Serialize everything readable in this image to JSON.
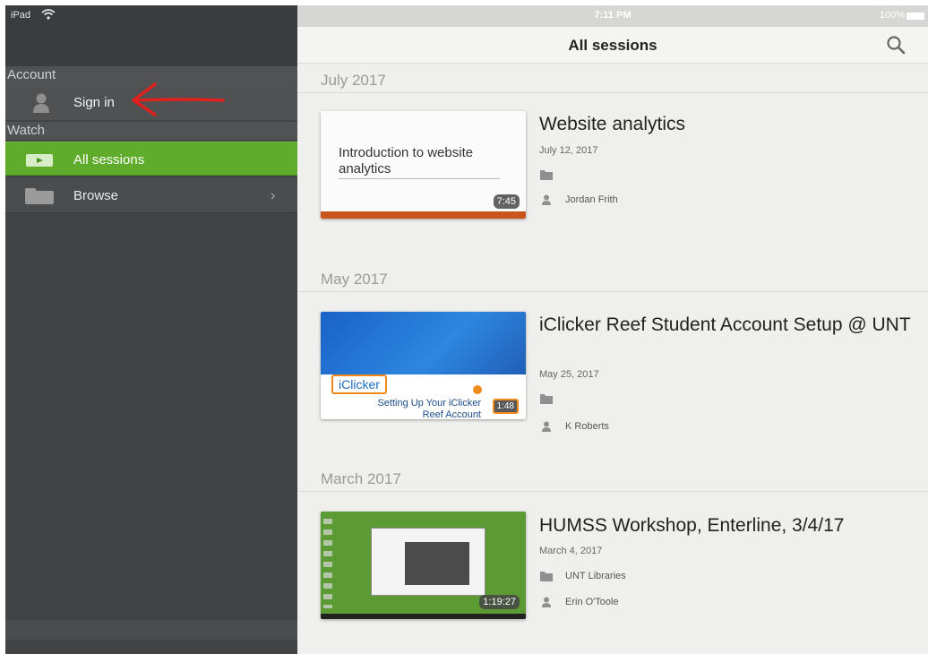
{
  "status_bar": {
    "carrier": "iPad",
    "time": "7:11 PM",
    "battery": "100%"
  },
  "sidebar": {
    "account_header": "Account",
    "sign_in_label": "Sign in",
    "watch_header": "Watch",
    "items": [
      {
        "label": "All sessions",
        "icon": "video-icon",
        "selected": true
      },
      {
        "label": "Browse",
        "icon": "folder-icon",
        "has_chevron": true
      }
    ]
  },
  "header": {
    "title": "All sessions"
  },
  "groups": [
    {
      "month": "July 2017",
      "session": {
        "title": "Website analytics",
        "date": "July 12, 2017",
        "folder": "",
        "presenter": "Jordan Frith",
        "duration": "7:45",
        "thumb_title": "Introduction to website analytics"
      }
    },
    {
      "month": "May 2017",
      "session": {
        "title": "iClicker Reef Student Account Setup @ UNT",
        "date": "May 25, 2017",
        "folder": "",
        "presenter": "K Roberts",
        "duration": "1:48",
        "thumb_logo": "iClicker",
        "thumb_text": "Setting Up Your iClicker Reef Account"
      }
    },
    {
      "month": "March 2017",
      "session": {
        "title": "HUMSS Workshop, Enterline, 3/4/17",
        "date": "March 4, 2017",
        "folder": "UNT Libraries",
        "presenter": "Erin O'Toole",
        "duration": "1:19:27"
      }
    }
  ],
  "colors": {
    "sidebar_bg": "#414345",
    "selected_green": "#5fab2b",
    "arrow_red": "#e0201c",
    "main_bg": "#efefed"
  }
}
